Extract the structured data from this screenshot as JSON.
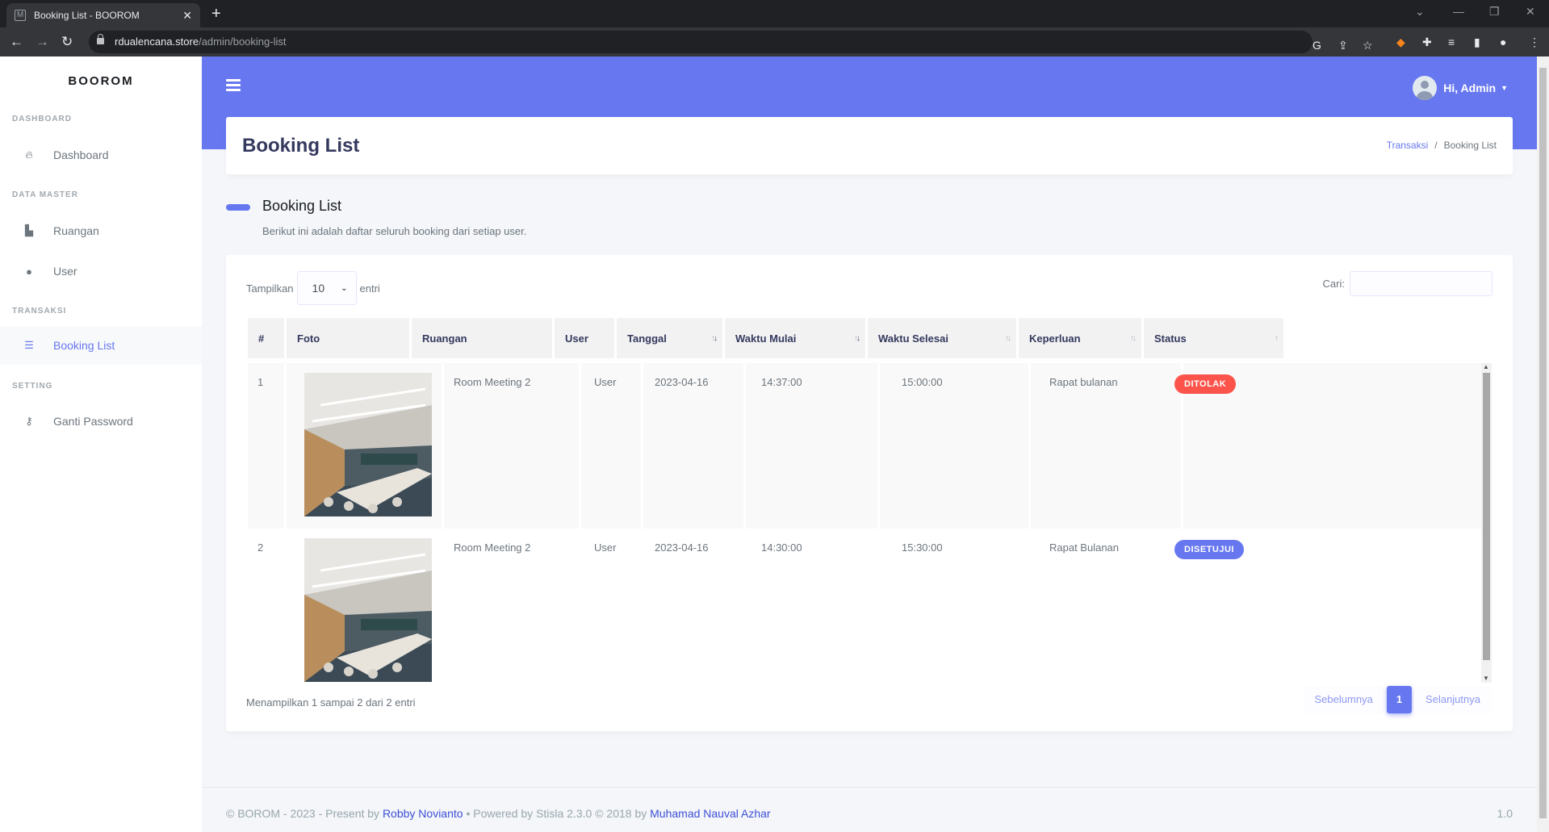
{
  "browser": {
    "tab_title": "Booking List - BOOROM",
    "url_host": "rdualencana.store",
    "url_path": "/admin/booking-list"
  },
  "sidebar": {
    "brand": "BOOROM",
    "sections": [
      {
        "header": "DASHBOARD",
        "items": [
          {
            "label": "Dashboard",
            "icon": "fire-icon"
          }
        ]
      },
      {
        "header": "DATA MASTER",
        "items": [
          {
            "label": "Ruangan",
            "icon": "building-icon"
          },
          {
            "label": "User",
            "icon": "user-icon"
          }
        ]
      },
      {
        "header": "TRANSAKSI",
        "items": [
          {
            "label": "Booking List",
            "icon": "list-icon",
            "active": true
          }
        ]
      },
      {
        "header": "SETTING",
        "items": [
          {
            "label": "Ganti Password",
            "icon": "key-icon"
          }
        ]
      }
    ]
  },
  "navbar": {
    "greeting": "Hi, Admin"
  },
  "page": {
    "title": "Booking List",
    "breadcrumb": [
      "Transaksi",
      "Booking List"
    ],
    "section_title": "Booking List",
    "section_lead": "Berikut ini adalah daftar seluruh booking dari setiap user."
  },
  "table": {
    "length_label_before": "Tampilkan",
    "length_value": "10",
    "length_label_after": "entri",
    "search_label": "Cari:",
    "columns": [
      "#",
      "Foto",
      "Ruangan",
      "User",
      "Tanggal",
      "Waktu Mulai",
      "Waktu Selesai",
      "Keperluan",
      "Status"
    ],
    "rows": [
      {
        "no": "1",
        "ruangan": "Room Meeting 2",
        "user": "User",
        "tanggal": "2023-04-16",
        "mulai": "14:37:00",
        "selesai": "15:00:00",
        "keperluan": "Rapat bulanan",
        "status": "DITOLAK",
        "status_color": "#fc544b"
      },
      {
        "no": "2",
        "ruangan": "Room Meeting 2",
        "user": "User",
        "tanggal": "2023-04-16",
        "mulai": "14:30:00",
        "selesai": "15:30:00",
        "keperluan": "Rapat Bulanan",
        "status": "DISETUJUI",
        "status_color": "#6777ef"
      }
    ],
    "info": "Menampilkan 1 sampai 2 dari 2 entri",
    "prev": "Sebelumnya",
    "current_page": "1",
    "next": "Selanjutnya"
  },
  "footer": {
    "prefix": "© BOROM - 2023 - Present by",
    "author": "Robby Novianto",
    "middle": "• Powered by Stisla 2.3.0 © 2018 by",
    "stisla_author": "Muhamad Nauval Azhar",
    "version": "1.0"
  },
  "colors": {
    "primary": "#6777ef",
    "danger": "#fc544b"
  }
}
